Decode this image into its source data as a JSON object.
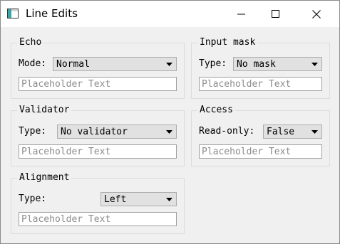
{
  "window": {
    "title": "Line Edits"
  },
  "echo": {
    "title": "Echo",
    "mode_label": "Mode:",
    "mode_value": "Normal",
    "placeholder": "Placeholder Text"
  },
  "input_mask": {
    "title": "Input mask",
    "type_label": "Type:",
    "type_value": "No mask",
    "placeholder": "Placeholder Text"
  },
  "validator": {
    "title": "Validator",
    "type_label": "Type:",
    "type_value": "No validator",
    "placeholder": "Placeholder Text"
  },
  "access": {
    "title": "Access",
    "readonly_label": "Read-only:",
    "readonly_value": "False",
    "placeholder": "Placeholder Text"
  },
  "alignment": {
    "title": "Alignment",
    "type_label": "Type:",
    "type_value": "Left",
    "placeholder": "Placeholder Text"
  },
  "icons": {
    "app": "app-window-icon",
    "minimize": "minimize-icon",
    "maximize": "maximize-icon",
    "close": "close-icon",
    "dropdown": "chevron-down-icon"
  }
}
